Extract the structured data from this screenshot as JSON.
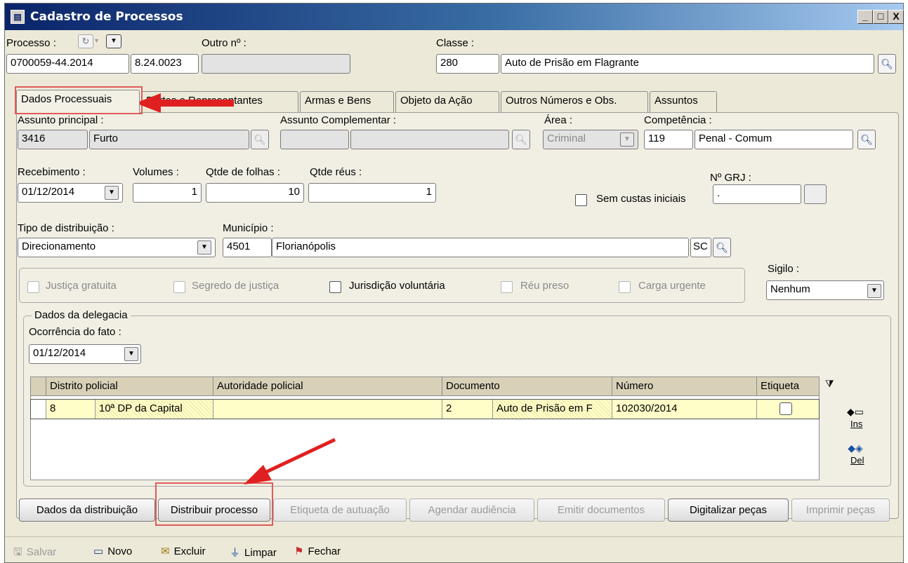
{
  "window": {
    "title": "Cadastro de Processos",
    "controls": [
      "_",
      "□",
      "X"
    ]
  },
  "header": {
    "processo_label": "Processo :",
    "processo_num": "0700059-44.2014",
    "processo_suffix": "8.24.0023",
    "outro_label": "Outro nº :",
    "outro_value": "",
    "classe_label": "Classe :",
    "classe_code": "280",
    "classe_name": "Auto de Prisão em Flagrante"
  },
  "tabs": [
    "Dados Processuais",
    "Partes e Representantes",
    "Armas e Bens",
    "Objeto da Ação",
    "Outros Números e Obs.",
    "Assuntos"
  ],
  "form": {
    "assunto_principal_label": "Assunto principal :",
    "assunto_code": "3416",
    "assunto_name": "Furto",
    "assunto_comp_label": "Assunto Complementar :",
    "area_label": "Área :",
    "area_value": "Criminal",
    "competencia_label": "Competência :",
    "competencia_code": "119",
    "competencia_name": "Penal - Comum",
    "recebimento_label": "Recebimento :",
    "recebimento_value": "01/12/2014",
    "volumes_label": "Volumes :",
    "volumes_value": "1",
    "folhas_label": "Qtde de folhas :",
    "folhas_value": "10",
    "reus_label": "Qtde réus :",
    "reus_value": "1",
    "grj_label": "Nº GRJ :",
    "grj_value": ".",
    "sem_custas_label": "Sem custas iniciais",
    "tipo_dist_label": "Tipo de distribuição :",
    "tipo_dist_value": "Direcionamento",
    "municipio_label": "Município :",
    "municipio_code": "4501",
    "municipio_name": "Florianópolis",
    "municipio_uf": "SC",
    "sigilo_label": "Sigilo :",
    "sigilo_value": "Nenhum",
    "checks": {
      "justica_gratuita": "Justiça gratuita",
      "segredo": "Segredo de justiça",
      "jurisdicao": "Jurisdição voluntária",
      "reu_preso": "Réu preso",
      "carga_urgente": "Carga urgente"
    }
  },
  "delegacia": {
    "legend": "Dados da delegacia",
    "ocorrencia_label": "Ocorrência do fato :",
    "ocorrencia_value": "01/12/2014",
    "columns": [
      "Distrito policial",
      "Autoridade policial",
      "Documento",
      "Número",
      "Etiqueta"
    ],
    "rows": [
      {
        "distrito_code": "8",
        "distrito_name": "10ª DP da Capital",
        "autoridade": "",
        "doc_code": "2",
        "doc_name": "Auto de Prisão em F",
        "numero": "102030/2014"
      }
    ],
    "ins_label": "Ins",
    "del_label": "Del"
  },
  "actions": {
    "dados_distribuicao": "Dados da distribuição",
    "distribuir": "Distribuir processo",
    "etiqueta": "Etiqueta de autuação",
    "agendar": "Agendar audiência",
    "emitir": "Emitir documentos",
    "digitalizar": "Digitalizar peças",
    "imprimir": "Imprimir peças"
  },
  "toolbar": {
    "salvar": "Salvar",
    "novo": "Novo",
    "excluir": "Excluir",
    "limpar": "Limpar",
    "fechar": "Fechar"
  },
  "colors": {
    "highlight_box": "#e05a5a",
    "annotation_arrow": "#e02020",
    "grid_row": "#fffec8"
  }
}
